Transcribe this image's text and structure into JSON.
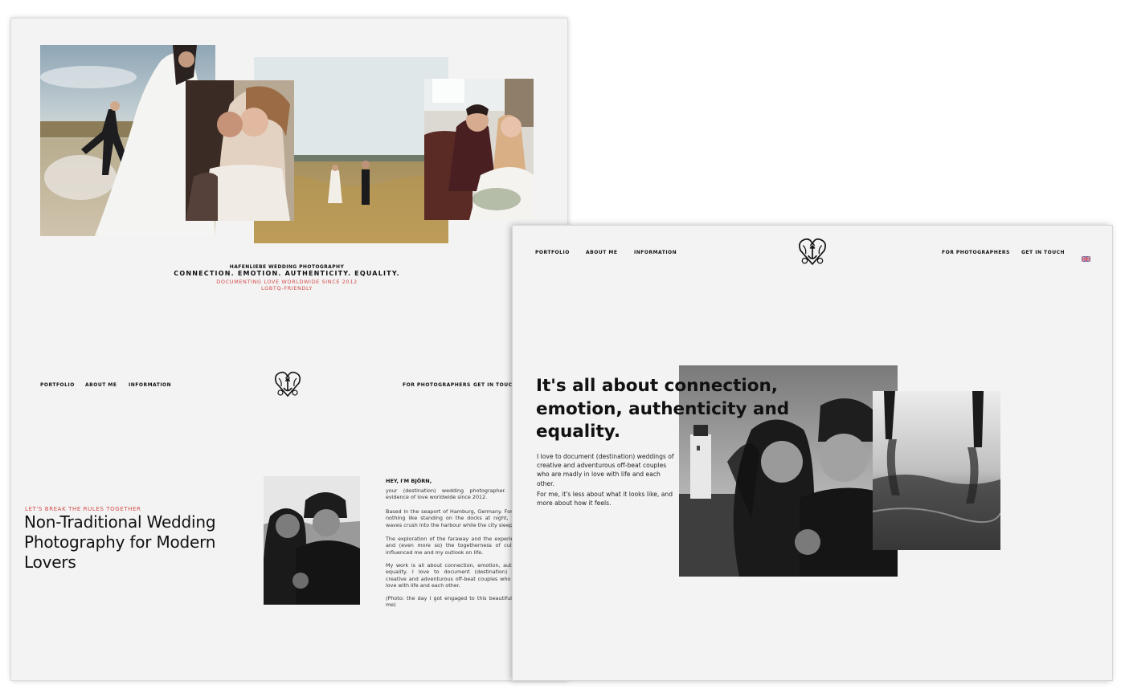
{
  "back_page": {
    "tagline": {
      "brand": "HAFENLIEBE WEDDING PHOTOGRAPHY",
      "values": "CONNECTION. EMOTION. AUTHENTICITY. EQUALITY.",
      "since": "DOCUMENTING LOVE WORLDWIDE SINCE 2012",
      "lgbtq": "LGBTQ-FRIENDLY"
    },
    "nav": {
      "portfolio": "PORTFOLIO",
      "about": "ABOUT ME",
      "information": "INFORMATION",
      "photographers": "FOR PHOTOGRAPHERS",
      "contact": "GET IN TOUCH"
    },
    "hero": {
      "kicker": "LET'S BREAK THE RULES TOGETHER",
      "title": "Non-Traditional Wedding Photography for Modern Lovers"
    },
    "bio": {
      "title": "HEY, I'M BJÖRN,",
      "p1": "your (destination) wedding photographer. Documenting evidence of love worldwide since 2012.",
      "p2": "Based in the seaport of Hamburg, Germany. For me, there is nothing like standing on the docks at night, watching the waves crush into the harbour while the city sleeps.",
      "p3": "The exploration of the faraway and the experience of clash and (even more so) the togetherness of cultures greatly influenced me and my outlook on life.",
      "p4": "My work is all about connection, emotion, authenticity and equality. I love to document (destination) weddings of creative and adventurous off-beat couples who are madly in love with life and each other.",
      "p5": "(Photo: the day I got engaged to this beautiful soul next to me)"
    }
  },
  "front_page": {
    "nav": {
      "portfolio": "PORTFOLIO",
      "about": "ABOUT ME",
      "information": "INFORMATION",
      "photographers": "FOR PHOTOGRAPHERS",
      "contact": "GET IN TOUCH"
    },
    "hero": {
      "title": "It's all about connection, emotion, authenticity and equality.",
      "p1": "I love to document (destination) weddings of creative and adventurous off-beat couples who are madly in love with life and each other.",
      "p2": "For me, it's less about what it looks like, and more about how it feels."
    }
  },
  "colors": {
    "accent_red": "#d24d4a",
    "page_bg": "#f3f3f3",
    "text": "#111111"
  },
  "icons": {
    "logo": "heart-anchor-emblem-icon",
    "language_flag": "uk-flag-icon"
  }
}
